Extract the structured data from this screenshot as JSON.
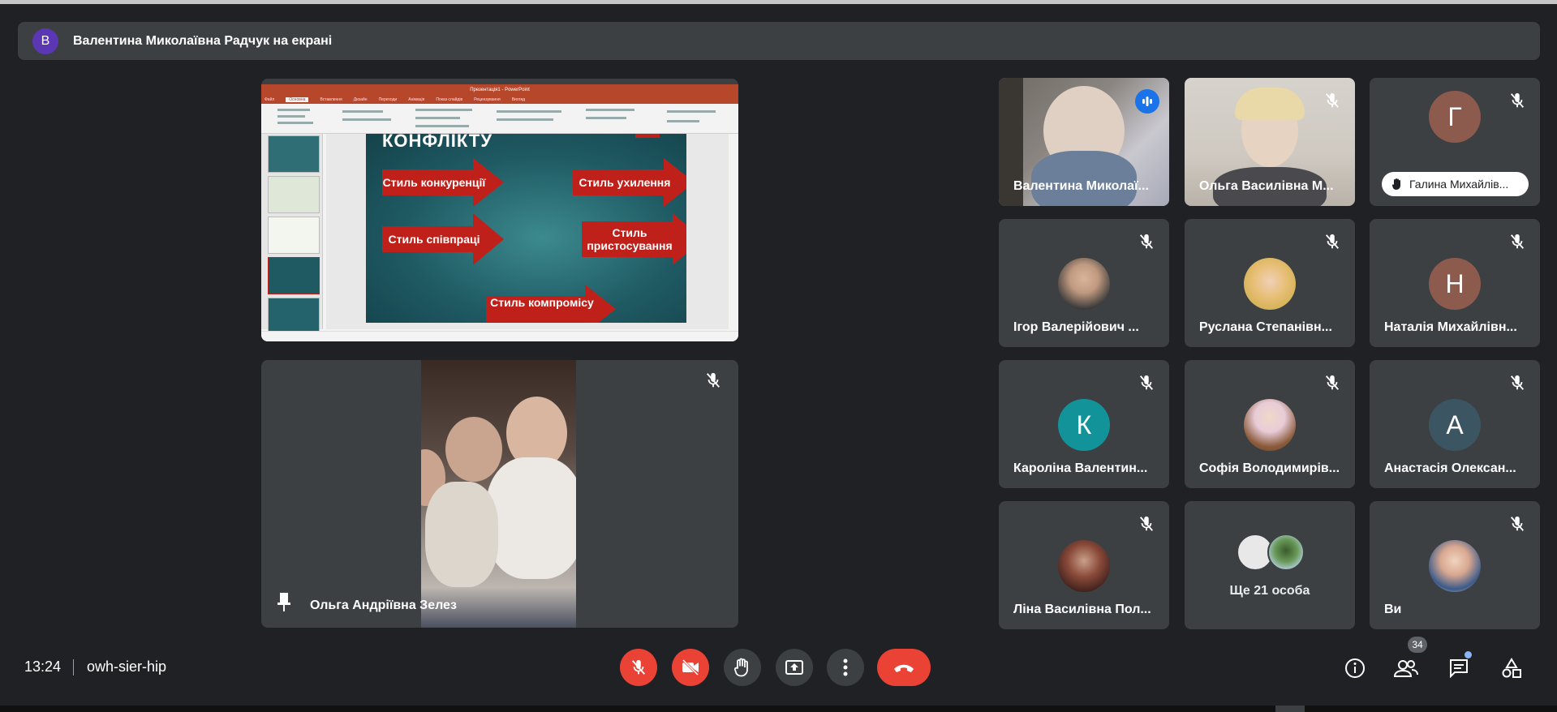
{
  "banner": {
    "avatar_letter": "В",
    "text": "Валентина Миколаївна Радчук на екрані",
    "avatar_color": "#5c37b3"
  },
  "presentation": {
    "window_title": "Презентація1 - PowerPoint",
    "tabs": [
      "Файл",
      "Основна",
      "Вставлення",
      "Дизайн",
      "Переходи",
      "Анімація",
      "Показ слайдів",
      "Рецензування",
      "Вигляд"
    ],
    "slide_title": "КОНФЛІКТУ",
    "arrows": [
      "Стиль конкуренції",
      "Стиль ухилення",
      "Стиль співпраці",
      "Стиль пристосування",
      "Стиль компромісу"
    ]
  },
  "pinned": {
    "name": "Ольга Андріївна Зелез",
    "icon": "pin-icon"
  },
  "tiles": [
    {
      "name": "Валентина Миколаї...",
      "state": "speaking"
    },
    {
      "name": "Ольга Василівна М...",
      "state": "muted"
    },
    {
      "name": "Галина Михайлів...",
      "letter": "Г",
      "color": "#8d5a4e",
      "hand_raised": true,
      "state": "muted"
    },
    {
      "name": "Ігор Валерійович ...",
      "state": "muted"
    },
    {
      "name": "Руслана Степанівн...",
      "state": "muted"
    },
    {
      "name": "Наталія Михайлівн...",
      "letter": "Н",
      "color": "#8d5a4e",
      "state": "muted"
    },
    {
      "name": "Кароліна Валентин...",
      "letter": "К",
      "color": "#12939a",
      "state": "muted"
    },
    {
      "name": "Софія Володимирів...",
      "state": "muted"
    },
    {
      "name": "Анастасія Олексан...",
      "letter": "А",
      "color": "#3c5563",
      "state": "muted"
    },
    {
      "name": "Ліна Василівна Пол...",
      "state": "muted"
    },
    {
      "more_label": "Ще 21 особа"
    },
    {
      "name": "Ви",
      "state": "muted"
    }
  ],
  "bottom": {
    "time": "13:24",
    "meeting_code": "owh-sier-hip",
    "participants_count": "34",
    "accent_red": "#ea4335"
  }
}
